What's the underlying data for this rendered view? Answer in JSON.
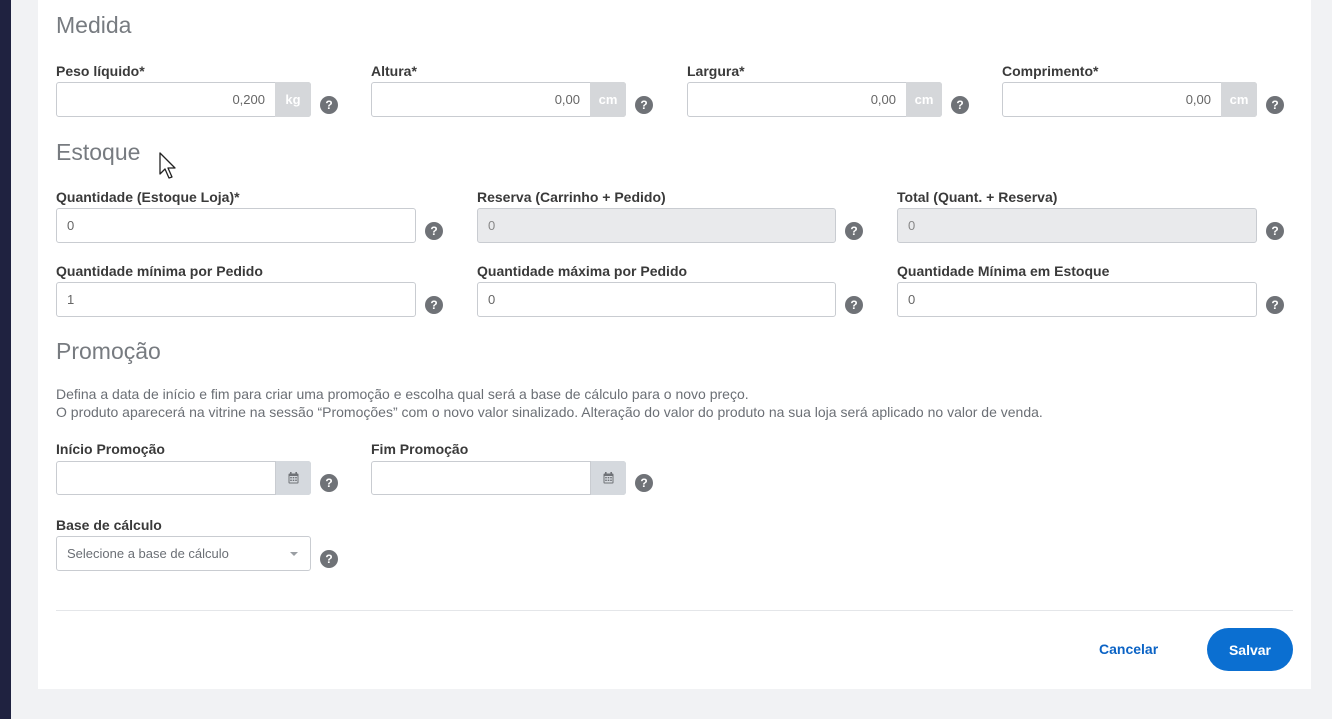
{
  "colors": {
    "primary": "#0b6fd1",
    "link": "#0b63c5",
    "sidebar": "#1f2240",
    "help": "#6f7277"
  },
  "medida": {
    "title": "Medida",
    "fields": [
      {
        "label": "Peso líquido*",
        "value": "0,200",
        "unit": "kg"
      },
      {
        "label": "Altura*",
        "value": "0,00",
        "unit": "cm"
      },
      {
        "label": "Largura*",
        "value": "0,00",
        "unit": "cm"
      },
      {
        "label": "Comprimento*",
        "value": "0,00",
        "unit": "cm"
      }
    ]
  },
  "estoque": {
    "title": "Estoque",
    "fields": [
      {
        "label": "Quantidade (Estoque Loja)*",
        "value": "0"
      },
      {
        "label": "Reserva (Carrinho + Pedido)",
        "value": "0"
      },
      {
        "label": "Total (Quant. + Reserva)",
        "value": "0"
      },
      {
        "label": "Quantidade mínima por Pedido",
        "value": "1"
      },
      {
        "label": "Quantidade máxima por Pedido",
        "value": "0"
      },
      {
        "label": "Quantidade Mínima em Estoque",
        "value": "0"
      }
    ]
  },
  "promocao": {
    "title": "Promoção",
    "desc_line1": "Defina a data de início e fim para criar uma promoção e escolha qual será a base de cálculo para o novo preço.",
    "desc_line2": "O produto aparecerá na vitrine na sessão “Promoções” com o novo valor sinalizado. Alteração do valor do produto na sua loja será aplicado no valor de venda.",
    "inicio_label": "Início Promoção",
    "fim_label": "Fim Promoção",
    "base_label": "Base de cálculo",
    "base_placeholder": "Selecione a base de cálculo"
  },
  "help_glyph": "?",
  "actions": {
    "cancel": "Cancelar",
    "save": "Salvar"
  }
}
